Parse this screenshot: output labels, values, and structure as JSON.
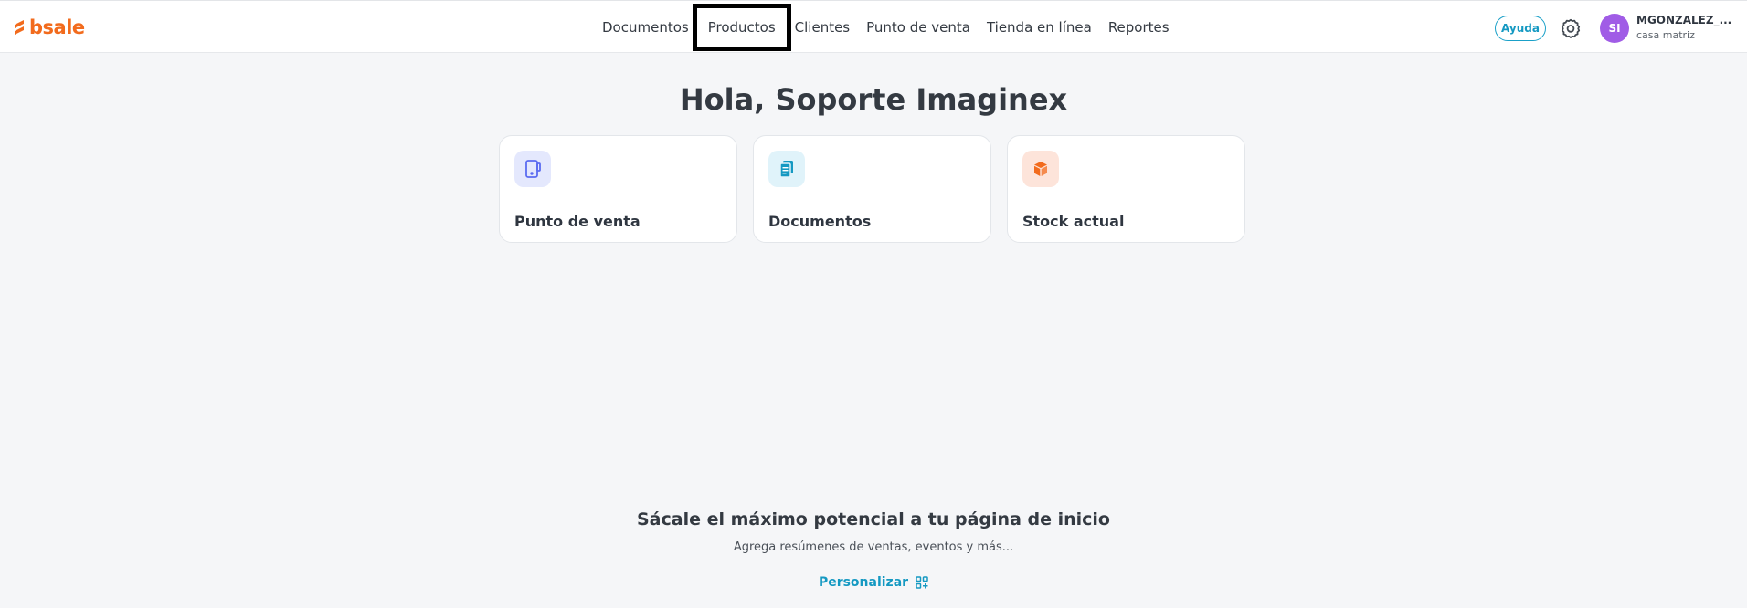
{
  "brand": {
    "logo_text": "bsale",
    "color": "#f26b1d"
  },
  "nav": [
    {
      "label": "Documentos"
    },
    {
      "label": "Productos"
    },
    {
      "label": "Clientes"
    },
    {
      "label": "Punto de venta"
    },
    {
      "label": "Tienda en línea"
    },
    {
      "label": "Reportes"
    }
  ],
  "header": {
    "help_label": "Ayuda",
    "settings_icon": "gear-icon",
    "user": {
      "initials": "SI",
      "name": "MGONZALEZ_...",
      "branch": "casa matriz"
    }
  },
  "greeting": "Hola, Soporte Imaginex",
  "cards": [
    {
      "label": "Punto de venta",
      "icon": "pos-device-icon",
      "icon_bg": "#e4e8fd",
      "icon_color": "#5b6bf0"
    },
    {
      "label": "Documentos",
      "icon": "document-icon",
      "icon_bg": "#e0f3fa",
      "icon_color": "#1599c2"
    },
    {
      "label": "Stock actual",
      "icon": "box-icon",
      "icon_bg": "#fde4da",
      "icon_color": "#f26b1d"
    }
  ],
  "promo": {
    "title": "Sácale el máximo potencial a tu página de inicio",
    "subtitle": "Agrega resúmenes de ventas, eventos y más...",
    "link_label": "Personalizar",
    "link_icon": "customize-grid-icon",
    "accent": "#1599c2"
  }
}
